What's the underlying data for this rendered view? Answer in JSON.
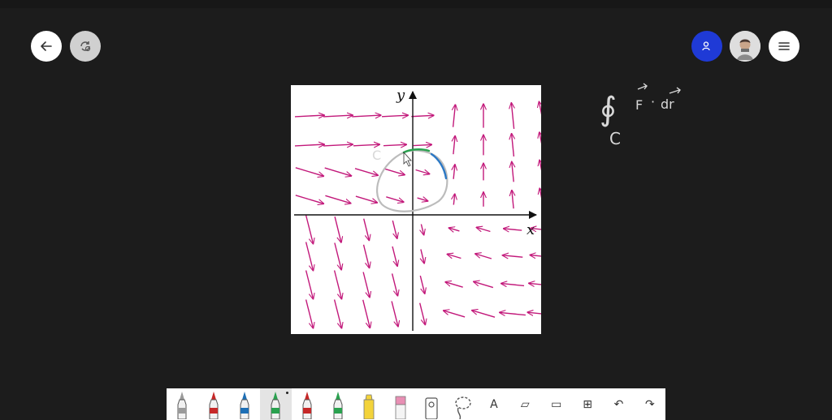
{
  "header": {
    "back_icon": "arrow-left-icon",
    "sync_icon": "refresh-icon",
    "user_icon": "person-icon",
    "avatar_icon": "user-avatar",
    "menu_icon": "hamburger-icon"
  },
  "colors": {
    "background": "#1c1c1c",
    "accent_blue": "#1f3ad6",
    "vector_field": "#c2187a",
    "ink_gray": "#bcbcbc",
    "ink_green": "#2aa14f",
    "ink_blue": "#2b78c5"
  },
  "figure": {
    "x_label": "x",
    "y_label": "y"
  },
  "annotations": {
    "integral_symbol": "∮",
    "integrand": "F · dr",
    "f_symbol": "F",
    "dot": "·",
    "dr_symbol": "dr",
    "contour_label": "C",
    "curve_label": "C"
  },
  "toolbar": {
    "tools": [
      {
        "name": "pencil-gray",
        "icon": "pencil-icon",
        "color": "#9a9a9a"
      },
      {
        "name": "pen-red",
        "icon": "pen-icon",
        "color": "#c62828"
      },
      {
        "name": "pen-blue",
        "icon": "pen-icon",
        "color": "#1e6fb5"
      },
      {
        "name": "pen-green",
        "icon": "pen-icon",
        "color": "#2aa14f",
        "active": true
      },
      {
        "name": "pen-multicolor-1",
        "icon": "pen-icon",
        "color": "#c62828"
      },
      {
        "name": "pen-multicolor-2",
        "icon": "pen-icon",
        "color": "#2aa14f"
      },
      {
        "name": "highlighter-yellow",
        "icon": "highlighter-icon",
        "color": "#f3d33b"
      },
      {
        "name": "eraser",
        "icon": "eraser-icon",
        "color": "#e88fb4"
      },
      {
        "name": "ruler",
        "icon": "ruler-icon",
        "color": "#555555"
      },
      {
        "name": "lasso",
        "icon": "lasso-icon",
        "color": "#555555"
      },
      {
        "name": "text",
        "icon": "text-icon",
        "glyph": "A"
      },
      {
        "name": "sticky-note",
        "icon": "note-icon",
        "glyph": "▱"
      },
      {
        "name": "image",
        "icon": "image-icon",
        "glyph": "▭"
      },
      {
        "name": "add",
        "icon": "plus-box-icon",
        "glyph": "⊞"
      },
      {
        "name": "undo",
        "icon": "undo-icon",
        "glyph": "↶"
      },
      {
        "name": "redo",
        "icon": "redo-icon",
        "glyph": "↷"
      }
    ]
  },
  "vector_field": {
    "columns_x": [
      -6,
      -5,
      -4,
      -3,
      -1,
      1,
      2,
      3,
      4
    ],
    "rows_y": [
      4,
      3,
      2,
      1,
      -1,
      -2,
      -3,
      -4
    ]
  }
}
